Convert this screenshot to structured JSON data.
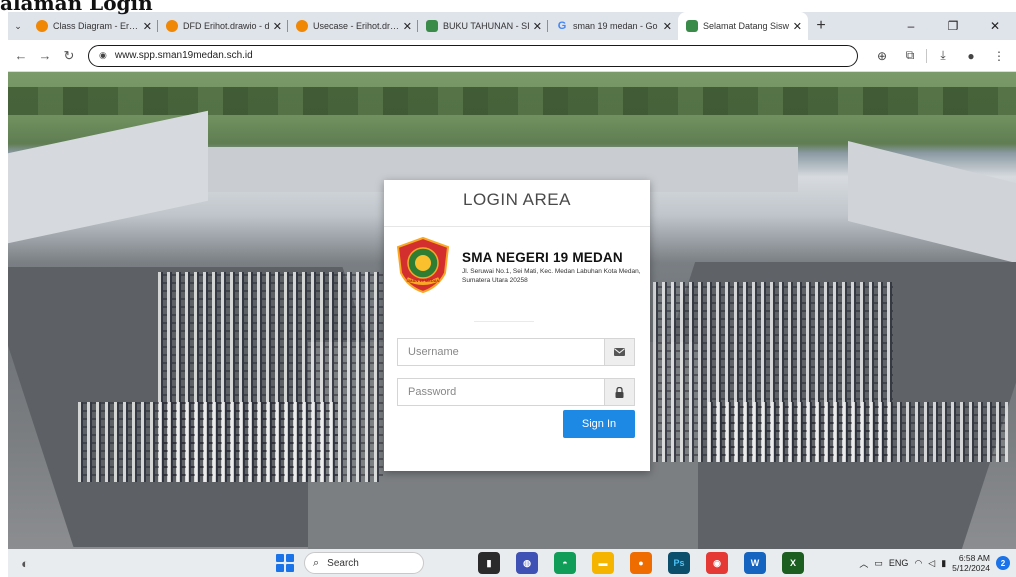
{
  "document": {
    "heading": "alaman Login"
  },
  "browser": {
    "tabs": [
      {
        "title": "Class Diagram - Erihot",
        "favicon": "drawio-icon",
        "active": false
      },
      {
        "title": "DFD Erihot.drawio - d",
        "favicon": "drawio-icon",
        "active": false
      },
      {
        "title": "Usecase - Erihot.draw",
        "favicon": "drawio-icon",
        "active": false
      },
      {
        "title": "BUKU TAHUNAN - SI",
        "favicon": "site-icon",
        "active": false
      },
      {
        "title": "sman 19 medan - Go",
        "favicon": "google-icon",
        "active": false
      },
      {
        "title": "Selamat Datang Sisw",
        "favicon": "site-icon",
        "active": true
      }
    ],
    "tab_close_glyph": "✕",
    "new_tab_glyph": "+",
    "url": "www.spp.sman19medan.sch.id",
    "window_controls": [
      "–",
      "❐",
      "✕"
    ]
  },
  "login": {
    "title": "LOGIN AREA",
    "school_name": "SMA NEGERI 19 MEDAN",
    "school_address": "Jl. Seruwai No.1, Sei Mati, Kec. Medan Labuhan Kota Medan, Sumatera Utara 20258",
    "username_placeholder": "Username",
    "password_placeholder": "Password",
    "signin_label": "Sign In",
    "logo_text": "SMAN 19 MEDAN"
  },
  "taskbar": {
    "search_label": "Search",
    "tray_lang": "ENG",
    "time": "6:58 AM",
    "date": "5/12/2024",
    "notification_count": "2"
  },
  "colors": {
    "accent": "#1e88e5",
    "drawio": "#f08705"
  }
}
